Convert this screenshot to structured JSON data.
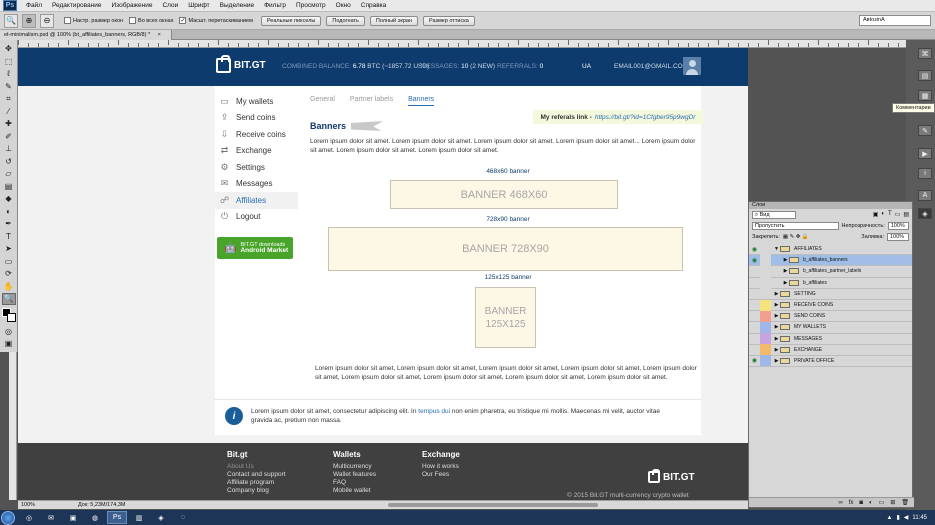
{
  "app": {
    "logo": "Ps",
    "menu": [
      "Файл",
      "Редактирование",
      "Изображение",
      "Слои",
      "Шрифт",
      "Выделение",
      "Фильтр",
      "Просмотр",
      "Окно",
      "Справка"
    ]
  },
  "options": {
    "checks": [
      {
        "label": "Настр. размер окон",
        "checked": false
      },
      {
        "label": "Во всех окнах",
        "checked": false
      },
      {
        "label": "Масшт. перетаскиванием",
        "checked": true
      }
    ],
    "buttons": [
      "Реальные пикселы",
      "Подогнать",
      "Полный экран",
      "Размер оттиска"
    ],
    "workspace": "АвtoзinA"
  },
  "doc_tab": {
    "title": "et-minimalism.psd @ 100% (bt_affiliates_banners, RGB/8) *"
  },
  "tooltip": "Комментарии",
  "site": {
    "logo": "BIT.GT",
    "header": {
      "balance_label": "COMBINED BALANCE:",
      "balance_value": "6.78",
      "balance_rest": "BTC (~1857.72 USD)",
      "messages_label": "MESSAGES:",
      "messages_value": "10",
      "messages_rest": "(2 NEW)",
      "referrals_label": "REFERRALS:",
      "referrals_value": "0",
      "lang": "UA",
      "email": "EMAIL001@GMAIL.COM"
    },
    "nav": [
      {
        "label": "My wallets",
        "icon": "wallet-icon",
        "glyph": "▭"
      },
      {
        "label": "Send coins",
        "icon": "send-icon",
        "glyph": "⇪"
      },
      {
        "label": "Receive coins",
        "icon": "receive-icon",
        "glyph": "⇩"
      },
      {
        "label": "Exchange",
        "icon": "exchange-icon",
        "glyph": "⇄"
      },
      {
        "label": "Settings",
        "icon": "gear-icon",
        "glyph": "⚙"
      },
      {
        "label": "Messages",
        "icon": "envelope-icon",
        "glyph": "✉"
      },
      {
        "label": "Affiliates",
        "icon": "affiliates-icon",
        "glyph": "☍"
      },
      {
        "label": "Logout",
        "icon": "power-icon",
        "glyph": "⏻"
      }
    ],
    "android": {
      "line1": "BIT.GT downloads",
      "line2": "Android Market"
    },
    "tabs": [
      "General",
      "Partner labels",
      "Banners"
    ],
    "active_tab": "Banners",
    "referral": {
      "label": "My referals link -",
      "link": "https://bit.gt/?id=1Cfgber95p9wgDr"
    },
    "section_title": "Banners",
    "lorem_top": "Lorem ipsum dolor sit amet. Lorem ipsum dolor sit amet. Lorem ipsum dolor sit amet. Lorem ipsum dolor sit amet... Lorem ipsum dolor sit amet. Lorem ipsum dolor sit amet. Lorem ipsum dolor sit amet.",
    "banners": [
      {
        "label": "468x60 banner",
        "text": "BANNER 468X60"
      },
      {
        "label": "728x90 banner",
        "text": "BANNER 728X90"
      },
      {
        "label": "125x125 banner",
        "text": "BANNER 125X125"
      }
    ],
    "lorem_bottom": "Lorem ipsum dolor sit amet, Lorem ipsum dolor sit amet, Lorem ipsum dolor sit amet, Lorem ipsum dolor sit amet, Lorem ipsum dolor sit amet, Lorem ipsum dolor sit amet, Lorem ipsum dolor sit amet, Lorem ipsum dolor sit amet, Lorem ipsum dolor sit amet.",
    "info": {
      "before": "Lorem ipsum dolor sit amet, consectetur adipiscing elit. In",
      "link": "tempus dui",
      "after": "non enim pharetra, eu tristique mi mollis. Maecenas mi velit, auctor vitae gravida ac, pretium non massa."
    },
    "footer": {
      "col1": {
        "title": "Bit.gt",
        "items": [
          "About Us",
          "Contact and support",
          "Affiliate program",
          "Company blog"
        ]
      },
      "col2": {
        "title": "Wallets",
        "items": [
          "Multicurrency",
          "Wallet features",
          "FAQ",
          "Mobile wallet"
        ]
      },
      "col3": {
        "title": "Exchange",
        "items": [
          "How it works",
          "Our Fees"
        ]
      },
      "logo": "BIT.GT",
      "copyright": "© 2015 Bit.GT multi-currency crypto wallet"
    }
  },
  "status": {
    "zoom": "100%",
    "doc": "Док: 5,23M/174,3M"
  },
  "layers": {
    "title": "Слои",
    "filter": "Вид",
    "blend": "Пропустить",
    "opacity_label": "Непрозрачность:",
    "opacity": "100%",
    "lock_label": "Закрепить:",
    "fill_label": "Заливка:",
    "fill": "100%",
    "items": [
      {
        "name": "AFFILIATES",
        "indent": 0,
        "visible": true,
        "open": true,
        "color": "#d7d7d7",
        "selected": false
      },
      {
        "name": "b_affiliates_banners",
        "indent": 1,
        "visible": true,
        "open": false,
        "color": "#d7d7d7",
        "selected": true
      },
      {
        "name": "b_affiliates_partner_labels",
        "indent": 1,
        "visible": false,
        "open": false,
        "color": "#d7d7d7",
        "selected": false
      },
      {
        "name": "b_affiliates",
        "indent": 1,
        "visible": false,
        "open": false,
        "color": "#d7d7d7",
        "selected": false
      },
      {
        "name": "SETTING",
        "indent": 0,
        "visible": false,
        "open": false,
        "color": "#d7d7d7",
        "selected": false
      },
      {
        "name": "RECEIVE COINS",
        "indent": 0,
        "visible": false,
        "open": false,
        "color": "#f5e27a",
        "selected": false
      },
      {
        "name": "SEND COINS",
        "indent": 0,
        "visible": false,
        "open": false,
        "color": "#f29f8f",
        "selected": false
      },
      {
        "name": "MY WALLETS",
        "indent": 0,
        "visible": false,
        "open": false,
        "color": "#9fb6e8",
        "selected": false
      },
      {
        "name": "MESSAGES",
        "indent": 0,
        "visible": false,
        "open": false,
        "color": "#c7a3e0",
        "selected": false
      },
      {
        "name": "EXCHANGE",
        "indent": 0,
        "visible": false,
        "open": false,
        "color": "#f5b96a",
        "selected": false
      },
      {
        "name": "PRIVATE OFFICE",
        "indent": 0,
        "visible": true,
        "open": false,
        "color": "#9fb6e8",
        "selected": false
      }
    ]
  },
  "taskbar": {
    "time": "11:45"
  }
}
